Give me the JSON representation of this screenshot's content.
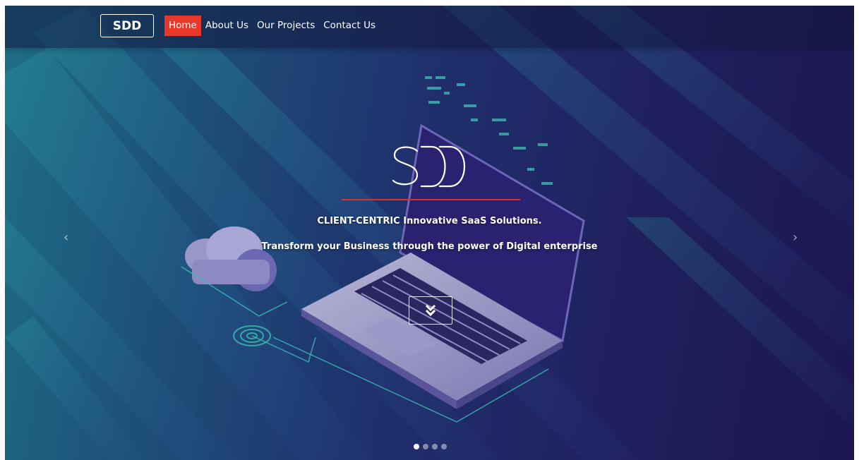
{
  "brand": {
    "label": "SDD"
  },
  "nav": {
    "items": [
      {
        "label": "Home",
        "active": true
      },
      {
        "label": "About Us",
        "active": false
      },
      {
        "label": "Our Projects",
        "active": false
      },
      {
        "label": "Contact Us",
        "active": false
      }
    ]
  },
  "hero": {
    "logo_text": "SDD",
    "tagline": "CLIENT-CENTRIC Innovative SaaS Solutions.",
    "subtitle": "Transform your Business through the power of Digital enterprise",
    "prev_icon": "‹",
    "next_icon": "›",
    "scroll_icon": "double-chevron-down-icon",
    "accent_color": "#e8382b",
    "slides": {
      "count": 4,
      "active_index": 0
    }
  }
}
